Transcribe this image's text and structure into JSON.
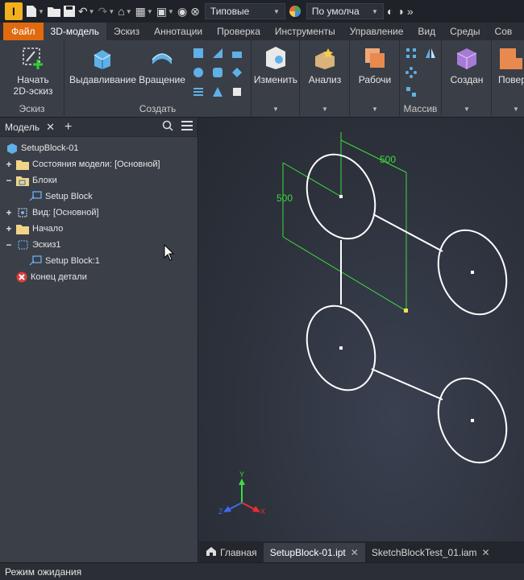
{
  "quick_access": {
    "logo_letter": "I",
    "appearance_value": "Типовые",
    "material_value": "По умолча"
  },
  "ribbon_tabs": [
    "Файл",
    "3D-модель",
    "Эскиз",
    "Аннотации",
    "Проверка",
    "Инструменты",
    "Управление",
    "Вид",
    "Среды",
    "Сов"
  ],
  "ribbon": {
    "sketch_group": {
      "button_line1": "Начать",
      "button_line2": "2D-эскиз",
      "label": "Эскиз"
    },
    "create_group": {
      "extrude": "Выдавливание",
      "revolve": "Вращение",
      "label": "Создать"
    },
    "modify": "Изменить",
    "analysis": "Анализ",
    "work": "Рабочи",
    "pattern_label": "Массив",
    "create_more": "Создан",
    "surface": "Повер"
  },
  "browser": {
    "title": "Модель",
    "items": [
      {
        "label": "SetupBlock-01",
        "expand": "",
        "indent": 0,
        "icon": "part-icon"
      },
      {
        "label": "Состояния модели: [Основной]",
        "expand": "+",
        "indent": 1,
        "icon": "folder-icon"
      },
      {
        "label": "Блоки",
        "expand": "−",
        "indent": 1,
        "icon": "blocks-folder-icon"
      },
      {
        "label": "Setup Block",
        "expand": "",
        "indent": 2,
        "icon": "block-icon"
      },
      {
        "label": "Вид: [Основной]",
        "expand": "+",
        "indent": 1,
        "icon": "view-icon"
      },
      {
        "label": "Начало",
        "expand": "+",
        "indent": 1,
        "icon": "folder-icon"
      },
      {
        "label": "Эскиз1",
        "expand": "−",
        "indent": 1,
        "icon": "sketch-icon"
      },
      {
        "label": "Setup Block:1",
        "expand": "",
        "indent": 2,
        "icon": "block-instance-icon"
      },
      {
        "label": "Конец детали",
        "expand": "",
        "indent": 1,
        "icon": "end-of-part-icon"
      }
    ]
  },
  "sketch": {
    "dim_horizontal": "500",
    "dim_vertical": "500"
  },
  "doc_tabs": [
    {
      "label": "Главная",
      "active": false,
      "closable": false
    },
    {
      "label": "SetupBlock-01.ipt",
      "active": true,
      "closable": true
    },
    {
      "label": "SketchBlockTest_01.iam",
      "active": false,
      "closable": true
    }
  ],
  "status": {
    "text": "Режим ожидания"
  },
  "colors": {
    "file_tab": "#e06a10",
    "dimension": "#3ddc3d",
    "sketch": "#ffffff"
  }
}
